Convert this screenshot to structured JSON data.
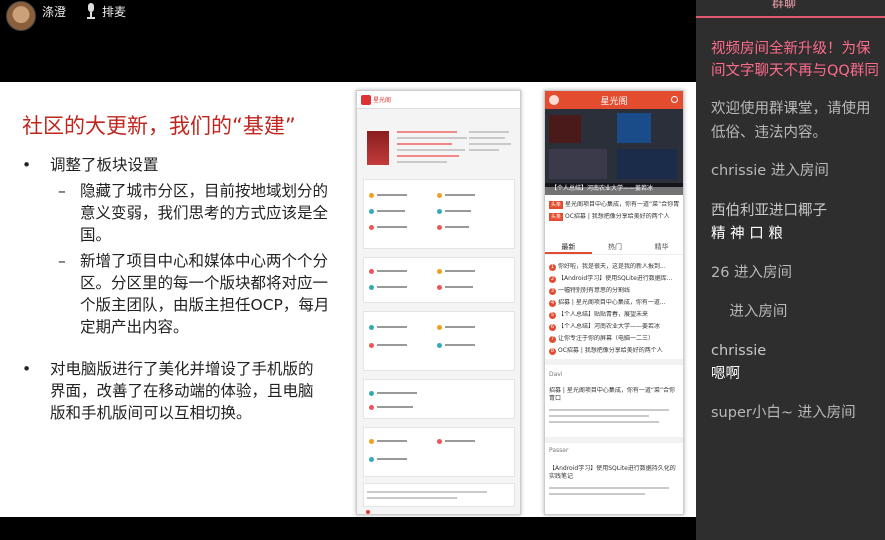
{
  "header": {
    "username": "涤澄",
    "queue_label": "排麦"
  },
  "slide": {
    "title": "社区的大更新，我们的“基建”",
    "bullet1": "调整了板块设置",
    "sub1": "隐藏了城市分区，目前按地域划分的意义变弱，我们思考的方式应该是全国。",
    "sub2": "新增了项目中心和媒体中心两个个分区。分区里的每一个版块都将对应一个版主团队，由版主担任OCP，每月定期产出内容。",
    "bullet2": "对电脑版进行了美化并增设了手机版的界面，改善了在移动端的体验，且电脑版和手机版间可以互相切换。"
  },
  "mobile": {
    "app_title": "星光阁",
    "banner_caption": "【个人总结】河南农业大学——姜若冰",
    "feature1": "星光阁项目中心集成，你有一道“菜”合你胃",
    "feature2": "OC招募 | 我想把像分享给美好的两个人",
    "tag": "头条",
    "tabs": [
      "最新",
      "热门",
      "精华"
    ],
    "list": [
      "你好啦，我是很天，这是我的新人报到...",
      "【Android学习】使用SQLite进行数据库...",
      "一幅特别别有意思的分割线",
      "招募 | 星光阁项目中心集成，你有一道...",
      "【个人总结】贴贴青春，展望未来",
      "【个人总结】河南农业大学——姜若冰",
      "让你专注于你的屏幕（电脑一二三）",
      "OC招募 | 我想把像分享给美好的两个人"
    ],
    "post1_author": "Davi",
    "post1_title": "招募 | 星光阁项目中心集成，你有一道“菜”合你胃口",
    "post2_author": "Passer",
    "post2_title": "【Android学习】使用SQLite进行数据持久化的实践笔记"
  },
  "chat": {
    "tab_label": "群聊",
    "messages": [
      {
        "type": "notice",
        "text": "视频房间全新升级！为保"
      },
      {
        "type": "notice",
        "text": "间文字聊天不再与QQ群同"
      },
      {
        "type": "system",
        "text": "欢迎使用群课堂，请使用"
      },
      {
        "type": "system",
        "text": "低俗、违法内容。"
      },
      {
        "type": "system",
        "text": "chrissie 进入房间"
      },
      {
        "type": "name",
        "text": "西伯利亚进口椰子"
      },
      {
        "type": "content",
        "text": "精 神 口 粮"
      },
      {
        "type": "system",
        "text": "26 进入房间"
      },
      {
        "type": "system",
        "text": "    进入房间"
      },
      {
        "type": "name",
        "text": "chrissie"
      },
      {
        "type": "content",
        "text": "嗯啊"
      },
      {
        "type": "system",
        "text": "super小白~ 进入房间"
      }
    ]
  },
  "colors": {
    "title_red": "#c0261f",
    "chat_notice": "#ff6b8b",
    "chat_bg": "#2e2e2e",
    "mobile_accent": "#e34c2e"
  }
}
